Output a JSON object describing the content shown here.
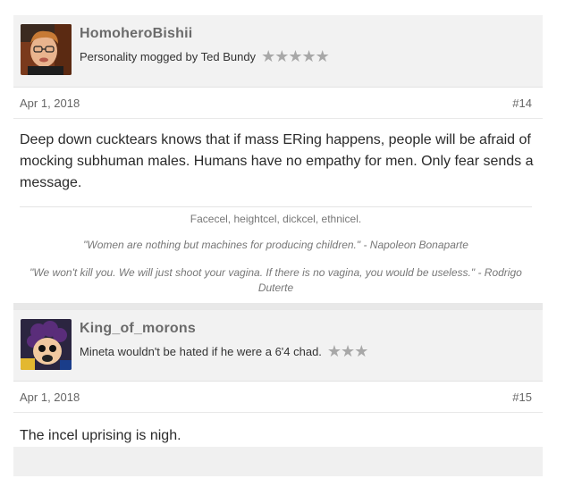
{
  "posts": [
    {
      "username": "HomoheroBishii",
      "title": "Personality mogged by Ted Bundy",
      "stars": "★★★★★",
      "date": "Apr 1, 2018",
      "number": "#14",
      "content": "Deep down cucktears knows that if mass ERing happens, people will be afraid of mocking subhuman males. Humans have no empathy for men. Only fear sends a message.",
      "signature": {
        "line": "Facecel, heightcel, dickcel, ethnicel.",
        "quote1": "\"Women are nothing but machines for producing children.\" - Napoleon Bonaparte",
        "quote2": "\"We won't kill you. We will just shoot your vagina. If there is no vagina, you would be useless.\" - Rodrigo Duterte"
      },
      "avatar": "avatar-photo"
    },
    {
      "username": "King_of_morons",
      "title": "Mineta wouldn't be hated if he were a 6'4 chad.",
      "stars": "★★★",
      "date": "Apr 1, 2018",
      "number": "#15",
      "content": "The incel uprising is nigh.",
      "avatar": "avatar-cartoon"
    }
  ],
  "colors": {
    "star": "#a8a8a8",
    "username": "#6b6b6b"
  }
}
